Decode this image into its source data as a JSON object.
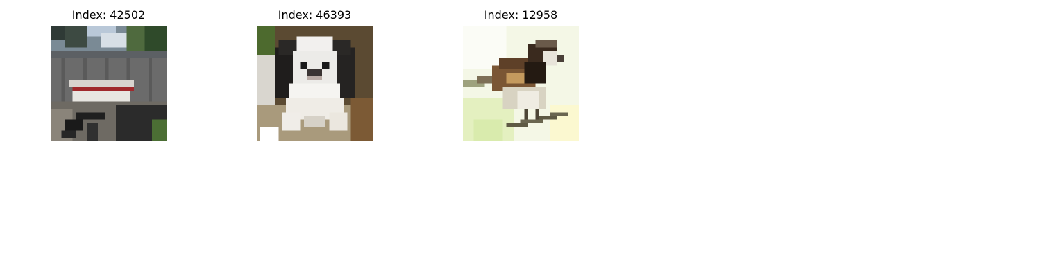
{
  "figure": {
    "panels": [
      {
        "title": "Index: 42502",
        "image_label": "boat on trailer in a fenced yard"
      },
      {
        "title": "Index: 46393",
        "image_label": "black and white small dog"
      },
      {
        "title": "Index: 12958",
        "image_label": "sparrow perched on a branch"
      }
    ]
  }
}
